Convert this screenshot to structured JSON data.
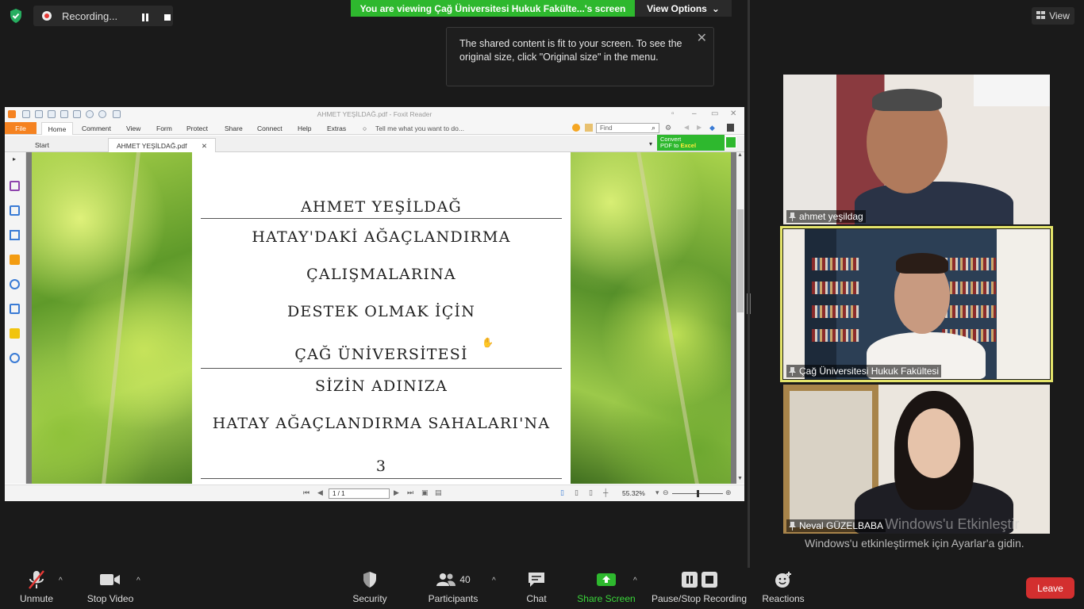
{
  "top_bar": {
    "recording_label": "Recording...",
    "viewing_banner": "You are viewing Çağ Üniversitesi Hukuk Fakülte...'s screen",
    "view_options": "View Options",
    "view_button": "View",
    "tooltip": "The shared content is fit to your screen. To see the original size, click \"Original size\" in the menu."
  },
  "foxit": {
    "window_title": "AHMET YEŞİLDAĞ.pdf - Foxit Reader",
    "menu": [
      "File",
      "Home",
      "Comment",
      "View",
      "Form",
      "Protect",
      "Share",
      "Connect",
      "Help",
      "Extras"
    ],
    "tell_me": "Tell me what you want to do...",
    "find_placeholder": "Find",
    "tabs": [
      "Start",
      "AHMET YEŞİLDAĞ.pdf"
    ],
    "convert_line1": "Convert",
    "convert_line2a": "PDF to ",
    "convert_line2b": "Excel",
    "page_indicator": "1 / 1",
    "zoom": "55.32%",
    "document": {
      "name": "AHMET YEŞİLDAĞ",
      "line1": "HATAY'DAKİ AĞAÇLANDIRMA",
      "line2": "ÇALIŞMALARINA",
      "line3": "DESTEK OLMAK İÇİN",
      "org": "ÇAĞ ÜNİVERSİTESİ",
      "line4": "SİZİN ADINIZA",
      "line5": "HATAY AĞAÇLANDIRMA SAHALARI'NA",
      "count": "3"
    }
  },
  "participants": [
    {
      "name": "ahmet yeşildag"
    },
    {
      "name": "Çağ Üniversitesi Hukuk Fakültesi"
    },
    {
      "name": "Neval GÜZELBABA"
    }
  ],
  "watermark": {
    "title": "Windows'u Etkinleştir",
    "subtitle": "Windows'u etkinleştirmek için Ayarlar'a gidin."
  },
  "toolbar": {
    "unmute": "Unmute",
    "stop_video": "Stop Video",
    "security": "Security",
    "participants": "Participants",
    "participants_count": "40",
    "chat": "Chat",
    "share_screen": "Share Screen",
    "pause_stop_recording": "Pause/Stop Recording",
    "reactions": "Reactions",
    "leave": "Leave"
  },
  "colors": {
    "banner_green": "#2eb82e",
    "leave_red": "#d32f2f",
    "active_speaker": "#e4e46a",
    "foxit_orange": "#f58220"
  }
}
